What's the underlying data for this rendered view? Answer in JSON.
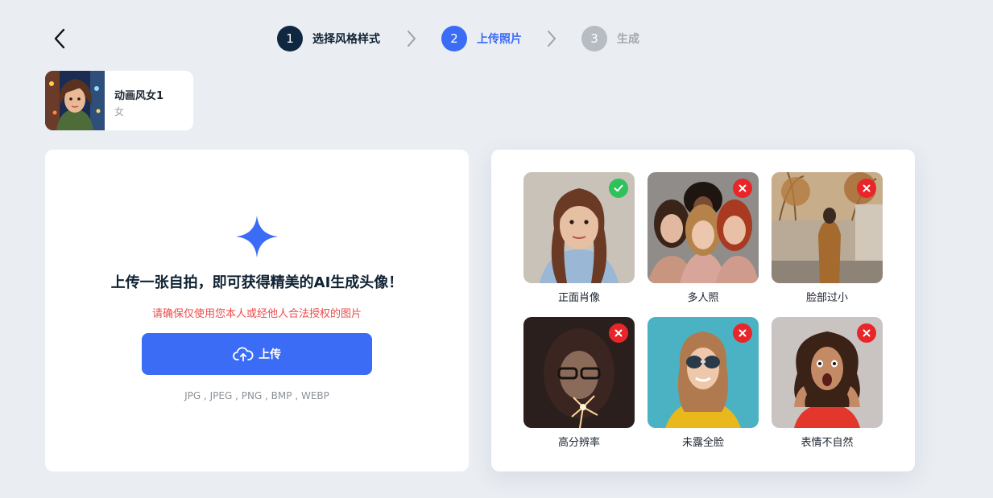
{
  "header": {
    "back_icon": "chevron-left-icon",
    "steps": [
      {
        "num": "1",
        "label": "选择风格样式",
        "state": "done"
      },
      {
        "num": "2",
        "label": "上传照片",
        "state": "active"
      },
      {
        "num": "3",
        "label": "生成",
        "state": "todo"
      }
    ]
  },
  "style_card": {
    "name": "动画风女1",
    "gender": "女"
  },
  "upload": {
    "icon": "sparkle-icon",
    "title": "上传一张自拍，即可获得精美的AI生成头像！",
    "warning": "请确保仅使用您本人或经他人合法授权的图片",
    "button_label": "上传",
    "button_icon": "cloud-upload-icon",
    "formats": "JPG , JPEG , PNG , BMP , WEBP"
  },
  "examples": [
    {
      "label": "正面肖像",
      "valid": true
    },
    {
      "label": "多人照",
      "valid": false
    },
    {
      "label": "脸部过小",
      "valid": false
    },
    {
      "label": "高分辨率",
      "valid": false
    },
    {
      "label": "未露全脸",
      "valid": false
    },
    {
      "label": "表情不自然",
      "valid": false
    }
  ],
  "colors": {
    "accent": "#3b6cf6",
    "warning": "#ec4b4b",
    "valid": "#2fc25b",
    "invalid": "#e8262a",
    "background": "#eaeef3"
  }
}
